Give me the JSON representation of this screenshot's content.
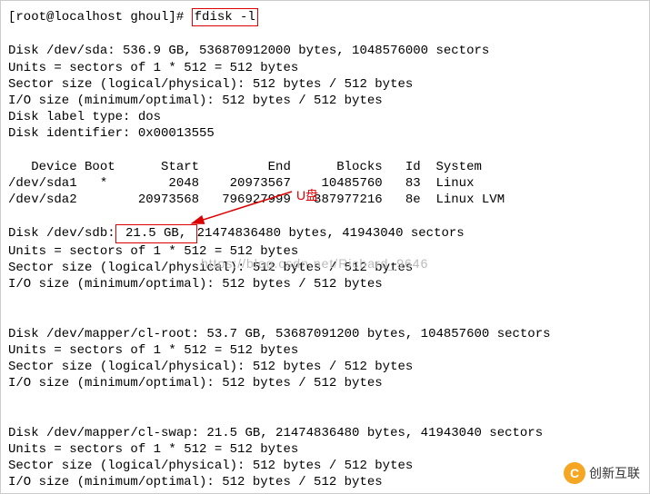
{
  "terminal": {
    "prompt": "[root@localhost ghoul]# ",
    "command": "fdisk -l",
    "disk_sda_header": "\nDisk /dev/sda: 536.9 GB, 536870912000 bytes, 1048576000 sectors",
    "disk_sda_units": "Units = sectors of 1 * 512 = 512 bytes",
    "disk_sda_sector": "Sector size (logical/physical): 512 bytes / 512 bytes",
    "disk_sda_io": "I/O size (minimum/optimal): 512 bytes / 512 bytes",
    "disk_sda_label": "Disk label type: dos",
    "disk_sda_id": "Disk identifier: 0x00013555",
    "partition_header": "\n   Device Boot      Start         End      Blocks   Id  System",
    "partition_sda1": "/dev/sda1   *        2048    20973567    10485760   83  Linux",
    "partition_sda2": "/dev/sda2        20973568   796927999   387977216   8e  Linux LVM",
    "disk_sdb_prefix": "\nDisk /dev/sdb:",
    "disk_sdb_size": " 21.5 GB, ",
    "disk_sdb_suffix": "21474836480 bytes, 41943040 sectors",
    "disk_sdb_units": "Units = sectors of 1 * 512 = 512 bytes",
    "disk_sdb_sector": "Sector size (logical/physical): 512 bytes / 512 bytes",
    "disk_sdb_io": "I/O size (minimum/optimal): 512 bytes / 512 bytes",
    "disk_clroot_header": "\n\nDisk /dev/mapper/cl-root: 53.7 GB, 53687091200 bytes, 104857600 sectors",
    "disk_clroot_units": "Units = sectors of 1 * 512 = 512 bytes",
    "disk_clroot_sector": "Sector size (logical/physical): 512 bytes / 512 bytes",
    "disk_clroot_io": "I/O size (minimum/optimal): 512 bytes / 512 bytes",
    "disk_clswap_header": "\n\nDisk /dev/mapper/cl-swap: 21.5 GB, 21474836480 bytes, 41943040 sectors",
    "disk_clswap_units": "Units = sectors of 1 * 512 = 512 bytes",
    "disk_clswap_sector": "Sector size (logical/physical): 512 bytes / 512 bytes",
    "disk_clswap_io": "I/O size (minimum/optimal): 512 bytes / 512 bytes"
  },
  "annotations": {
    "usb_label": "U盘",
    "watermark": "https://blog.csdn.net/Richard_9646"
  },
  "logo": {
    "icon_letter": "C",
    "text": "创新互联"
  }
}
